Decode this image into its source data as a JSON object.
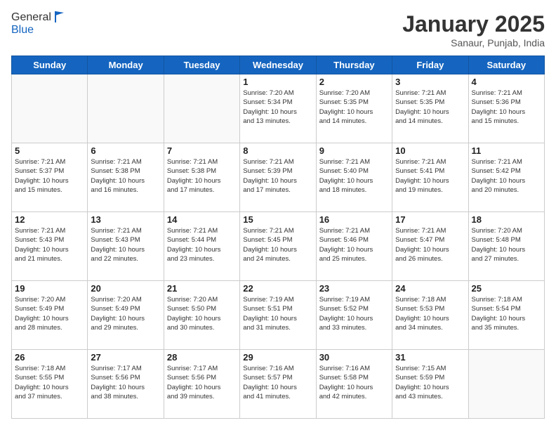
{
  "header": {
    "logo": {
      "line1": "General",
      "line2": "Blue"
    },
    "title": "January 2025",
    "location": "Sanaur, Punjab, India"
  },
  "days_of_week": [
    "Sunday",
    "Monday",
    "Tuesday",
    "Wednesday",
    "Thursday",
    "Friday",
    "Saturday"
  ],
  "weeks": [
    [
      {
        "day": "",
        "info": ""
      },
      {
        "day": "",
        "info": ""
      },
      {
        "day": "",
        "info": ""
      },
      {
        "day": "1",
        "info": "Sunrise: 7:20 AM\nSunset: 5:34 PM\nDaylight: 10 hours\nand 13 minutes."
      },
      {
        "day": "2",
        "info": "Sunrise: 7:20 AM\nSunset: 5:35 PM\nDaylight: 10 hours\nand 14 minutes."
      },
      {
        "day": "3",
        "info": "Sunrise: 7:21 AM\nSunset: 5:35 PM\nDaylight: 10 hours\nand 14 minutes."
      },
      {
        "day": "4",
        "info": "Sunrise: 7:21 AM\nSunset: 5:36 PM\nDaylight: 10 hours\nand 15 minutes."
      }
    ],
    [
      {
        "day": "5",
        "info": "Sunrise: 7:21 AM\nSunset: 5:37 PM\nDaylight: 10 hours\nand 15 minutes."
      },
      {
        "day": "6",
        "info": "Sunrise: 7:21 AM\nSunset: 5:38 PM\nDaylight: 10 hours\nand 16 minutes."
      },
      {
        "day": "7",
        "info": "Sunrise: 7:21 AM\nSunset: 5:38 PM\nDaylight: 10 hours\nand 17 minutes."
      },
      {
        "day": "8",
        "info": "Sunrise: 7:21 AM\nSunset: 5:39 PM\nDaylight: 10 hours\nand 17 minutes."
      },
      {
        "day": "9",
        "info": "Sunrise: 7:21 AM\nSunset: 5:40 PM\nDaylight: 10 hours\nand 18 minutes."
      },
      {
        "day": "10",
        "info": "Sunrise: 7:21 AM\nSunset: 5:41 PM\nDaylight: 10 hours\nand 19 minutes."
      },
      {
        "day": "11",
        "info": "Sunrise: 7:21 AM\nSunset: 5:42 PM\nDaylight: 10 hours\nand 20 minutes."
      }
    ],
    [
      {
        "day": "12",
        "info": "Sunrise: 7:21 AM\nSunset: 5:43 PM\nDaylight: 10 hours\nand 21 minutes."
      },
      {
        "day": "13",
        "info": "Sunrise: 7:21 AM\nSunset: 5:43 PM\nDaylight: 10 hours\nand 22 minutes."
      },
      {
        "day": "14",
        "info": "Sunrise: 7:21 AM\nSunset: 5:44 PM\nDaylight: 10 hours\nand 23 minutes."
      },
      {
        "day": "15",
        "info": "Sunrise: 7:21 AM\nSunset: 5:45 PM\nDaylight: 10 hours\nand 24 minutes."
      },
      {
        "day": "16",
        "info": "Sunrise: 7:21 AM\nSunset: 5:46 PM\nDaylight: 10 hours\nand 25 minutes."
      },
      {
        "day": "17",
        "info": "Sunrise: 7:21 AM\nSunset: 5:47 PM\nDaylight: 10 hours\nand 26 minutes."
      },
      {
        "day": "18",
        "info": "Sunrise: 7:20 AM\nSunset: 5:48 PM\nDaylight: 10 hours\nand 27 minutes."
      }
    ],
    [
      {
        "day": "19",
        "info": "Sunrise: 7:20 AM\nSunset: 5:49 PM\nDaylight: 10 hours\nand 28 minutes."
      },
      {
        "day": "20",
        "info": "Sunrise: 7:20 AM\nSunset: 5:49 PM\nDaylight: 10 hours\nand 29 minutes."
      },
      {
        "day": "21",
        "info": "Sunrise: 7:20 AM\nSunset: 5:50 PM\nDaylight: 10 hours\nand 30 minutes."
      },
      {
        "day": "22",
        "info": "Sunrise: 7:19 AM\nSunset: 5:51 PM\nDaylight: 10 hours\nand 31 minutes."
      },
      {
        "day": "23",
        "info": "Sunrise: 7:19 AM\nSunset: 5:52 PM\nDaylight: 10 hours\nand 33 minutes."
      },
      {
        "day": "24",
        "info": "Sunrise: 7:18 AM\nSunset: 5:53 PM\nDaylight: 10 hours\nand 34 minutes."
      },
      {
        "day": "25",
        "info": "Sunrise: 7:18 AM\nSunset: 5:54 PM\nDaylight: 10 hours\nand 35 minutes."
      }
    ],
    [
      {
        "day": "26",
        "info": "Sunrise: 7:18 AM\nSunset: 5:55 PM\nDaylight: 10 hours\nand 37 minutes."
      },
      {
        "day": "27",
        "info": "Sunrise: 7:17 AM\nSunset: 5:56 PM\nDaylight: 10 hours\nand 38 minutes."
      },
      {
        "day": "28",
        "info": "Sunrise: 7:17 AM\nSunset: 5:56 PM\nDaylight: 10 hours\nand 39 minutes."
      },
      {
        "day": "29",
        "info": "Sunrise: 7:16 AM\nSunset: 5:57 PM\nDaylight: 10 hours\nand 41 minutes."
      },
      {
        "day": "30",
        "info": "Sunrise: 7:16 AM\nSunset: 5:58 PM\nDaylight: 10 hours\nand 42 minutes."
      },
      {
        "day": "31",
        "info": "Sunrise: 7:15 AM\nSunset: 5:59 PM\nDaylight: 10 hours\nand 43 minutes."
      },
      {
        "day": "",
        "info": ""
      }
    ]
  ]
}
